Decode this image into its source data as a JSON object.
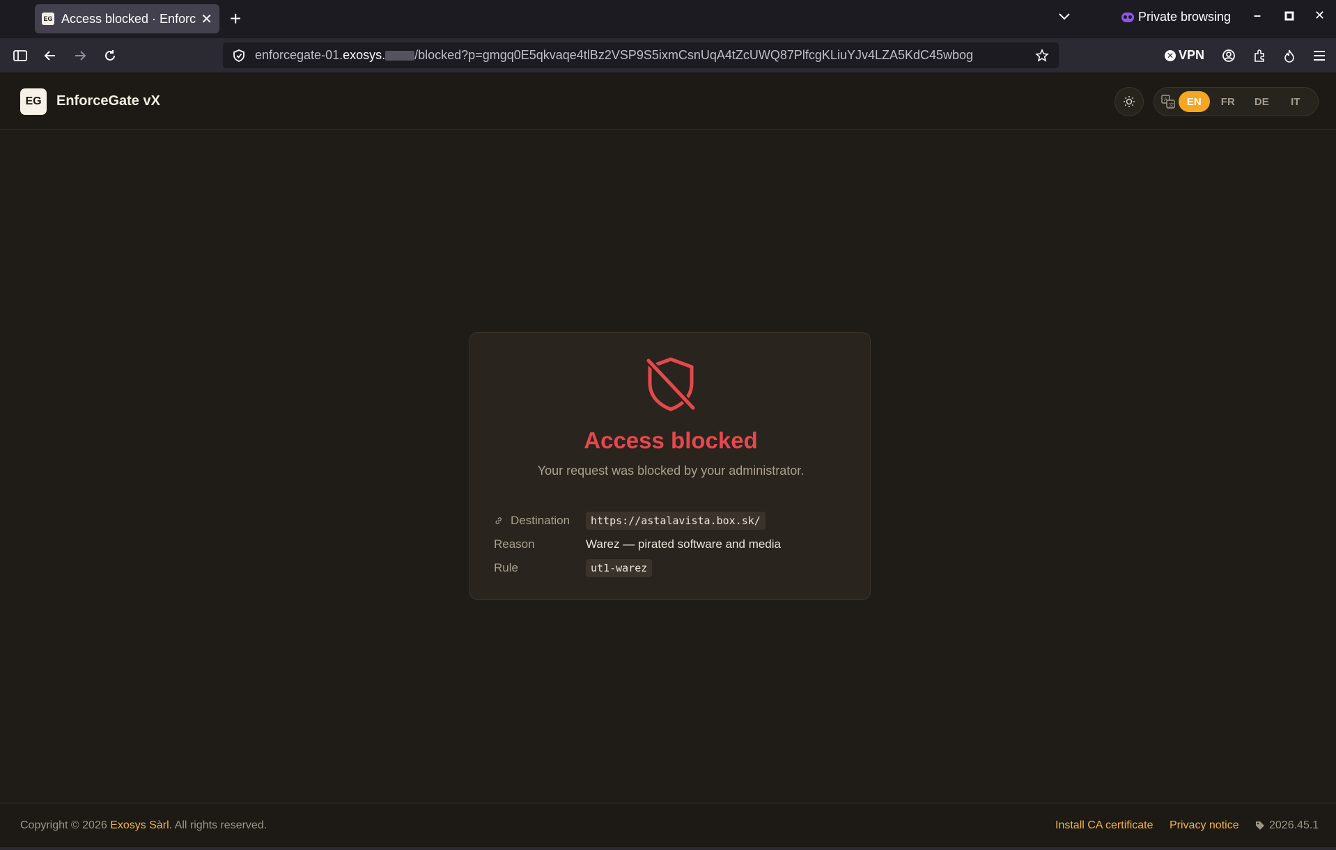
{
  "browser": {
    "tab_title": "Access blocked · EnforceGate vX",
    "tab_favicon": "EG",
    "private_label": "Private browsing",
    "url": {
      "prefix": "enforcegate-01.",
      "host": "exosys.",
      "path": "/blocked?p=gmgq0E5qkvaqe4tlBz2VSP9S5ixmCsnUqA4tZcUWQ87PlfcgKLiuYJv4LZA5KdC45wbog"
    },
    "vpn_label": "VPN"
  },
  "header": {
    "logo": "EG",
    "brand": "EnforceGate vX",
    "languages": [
      {
        "code": "EN",
        "active": true
      },
      {
        "code": "FR",
        "active": false
      },
      {
        "code": "DE",
        "active": false
      },
      {
        "code": "IT",
        "active": false
      }
    ]
  },
  "card": {
    "title": "Access blocked",
    "subtitle": "Your request was blocked by your administrator.",
    "details": {
      "destination_label": "Destination",
      "destination_value": "https://astalavista.box.sk/",
      "reason_label": "Reason",
      "reason_value": "Warez — pirated software and media",
      "rule_label": "Rule",
      "rule_value": "ut1-warez"
    }
  },
  "footer": {
    "copyright_prefix": "Copyright © 2026 ",
    "owner": "Exosys Sàrl",
    "copyright_suffix": ". All rights reserved.",
    "install_ca": "Install CA certificate",
    "privacy": "Privacy notice",
    "version": "2026.45.1"
  },
  "colors": {
    "accent": "#f5a623",
    "danger": "#e5484d",
    "background": "#1f1b16"
  }
}
